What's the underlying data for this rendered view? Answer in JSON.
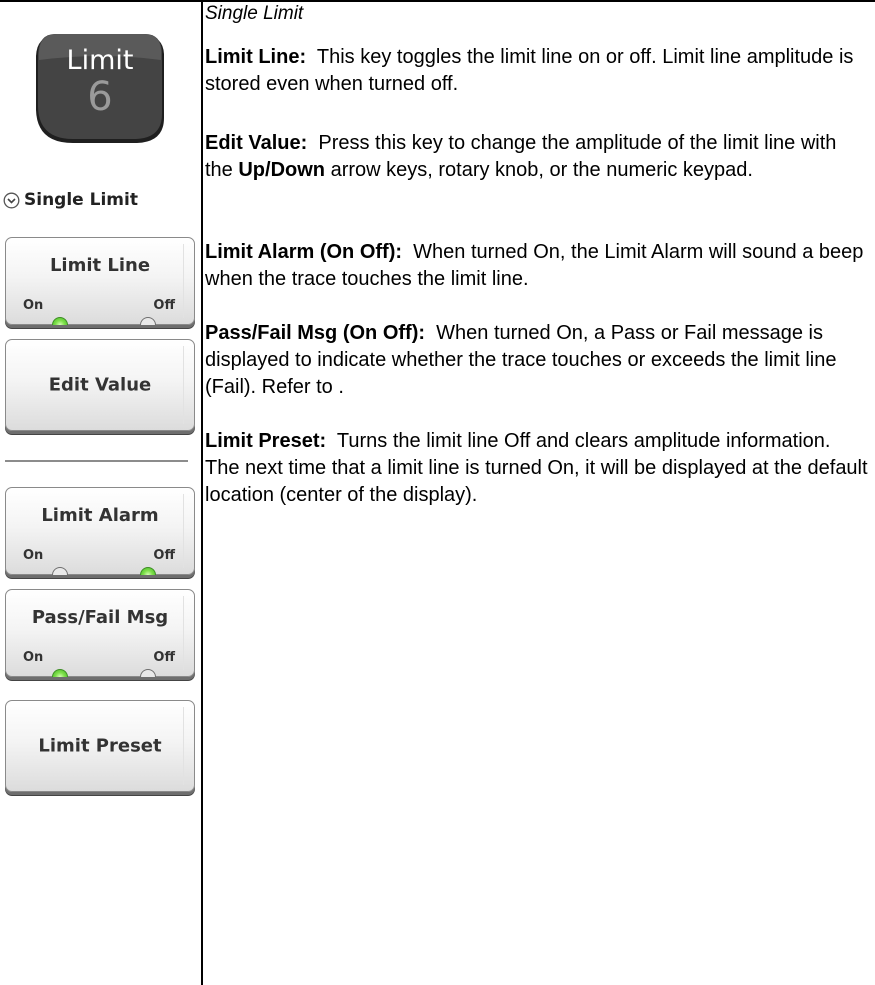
{
  "hardkey": {
    "name": "Limit",
    "number": "6"
  },
  "menu": {
    "title": "Single Limit",
    "title_icon": "chevron-down-circle-icon"
  },
  "softkeys": {
    "limit_line": {
      "label": "Limit Line",
      "on": "On",
      "off": "Off",
      "state": "On"
    },
    "edit_value": {
      "label": "Edit Value"
    },
    "limit_alarm": {
      "label": "Limit Alarm",
      "on": "On",
      "off": "Off",
      "state": "Off"
    },
    "pass_fail": {
      "label": "Pass/Fail Msg",
      "on": "On",
      "off": "Off",
      "state": "On"
    },
    "limit_preset": {
      "label": "Limit Preset"
    }
  },
  "content": {
    "section_title": "Single Limit",
    "descriptions": [
      {
        "term": "Limit Line:",
        "text": "This key toggles the limit line on or off. Limit line amplitude is stored even when turned off."
      },
      {
        "term": "Edit Value:",
        "text_before": "Press this key to change the amplitude of the limit line with the ",
        "bold": "Up/Down",
        "text_after": " arrow keys, rotary knob, or the numeric keypad."
      },
      {
        "term": "Limit Alarm (On  Off):",
        "text": "When turned On, the Limit Alarm will sound a beep when the trace touches the limit line."
      },
      {
        "term": "Pass/Fail Msg (On  Off):",
        "text": "When turned On, a Pass or Fail message is displayed to indicate whether the trace touches or exceeds the limit line (Fail). Refer to ."
      },
      {
        "term": "Limit Preset:",
        "text": "Turns the limit line Off and clears amplitude information. The next time that a limit line is turned On, it will be displayed at the default location (center of the display)."
      }
    ]
  },
  "colors": {
    "led_on": "#5fcf3a",
    "led_off": "#e9e9e9",
    "hardkey_body": "#3a3a3a"
  }
}
